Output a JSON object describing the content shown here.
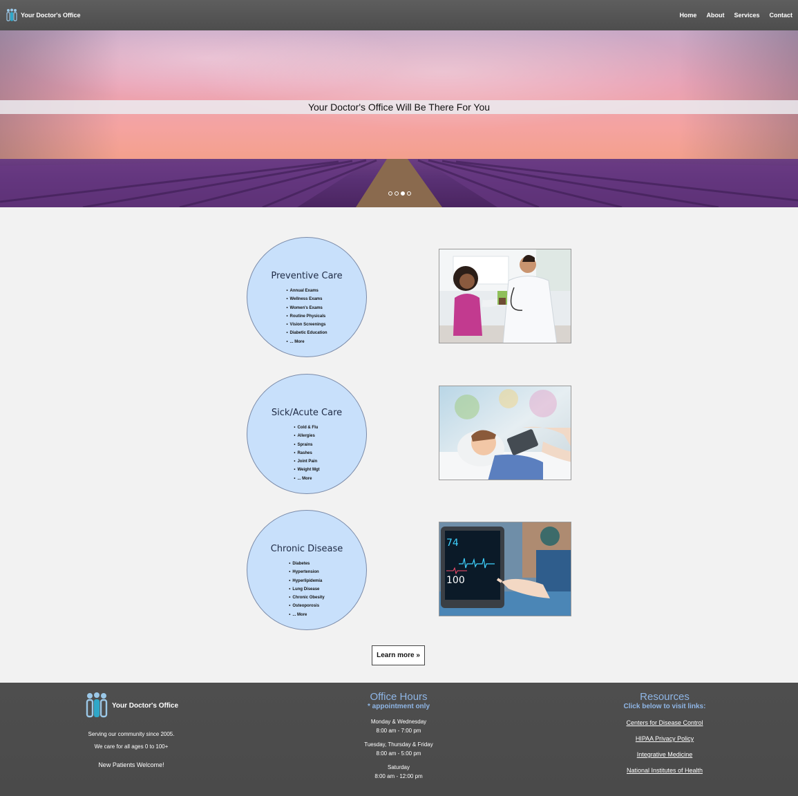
{
  "nav": {
    "brand": "Your Doctor's Office",
    "links": [
      "Home",
      "About",
      "Services",
      "Contact"
    ]
  },
  "hero": {
    "banner_text": "Your Doctor's Office Will Be There For You",
    "slide_count": 4,
    "active_slide": 3
  },
  "services": [
    {
      "title": "Preventive Care",
      "items": [
        "Annual Exams",
        "Wellness Exams",
        "Women's Exams",
        "Routine Physicals",
        "Vision Screenings",
        "Diabetic Education",
        "... More"
      ],
      "photo": "doctor-with-child-photo"
    },
    {
      "title": "Sick/Acute Care",
      "items": [
        "Cold & Flu",
        "Allergies",
        "Sprains",
        "Rashes",
        "Joint Pain",
        "Weight Mgt",
        "... More"
      ],
      "photo": "boy-patient-photo"
    },
    {
      "title": "Chronic Disease",
      "items": [
        "Diabetes",
        "Hypertension",
        "Hyperlipidemia",
        "Lung Disease",
        "Chronic Obesity",
        "Osteoporosis",
        "... More"
      ],
      "photo": "patient-monitor-photo"
    }
  ],
  "learn_more": "Learn more »",
  "monitor": {
    "top": "74",
    "bottom": "100"
  },
  "footer": {
    "brand": "Your Doctor's Office",
    "tagline1": "Serving our community since 2005.",
    "tagline2": "We care for all ages 0 to 100+",
    "welcome": "New Patients Welcome!",
    "hours_title": "Office Hours",
    "hours_note": "* appointment only",
    "hours": [
      {
        "days": "Monday & Wednesday",
        "time": "8:00 am - 7:00 pm"
      },
      {
        "days": "Tuesday, Thursday & Friday",
        "time": "8:00 am - 5:00 pm"
      },
      {
        "days": "Saturday",
        "time": "8:00 am - 12:00 pm"
      }
    ],
    "resources_title": "Resources",
    "resources_note": "Click below to visit links:",
    "resources": [
      "Centers for Disease Control",
      "HIPAA Privacy Policy",
      "Integrative Medicine",
      "National Institutes of Health"
    ]
  },
  "colors": {
    "navbar": "#555555",
    "circle_fill": "#c8e0fb",
    "footer_heading": "#8fb6e6",
    "footer_bg": "#4c4c4c"
  }
}
